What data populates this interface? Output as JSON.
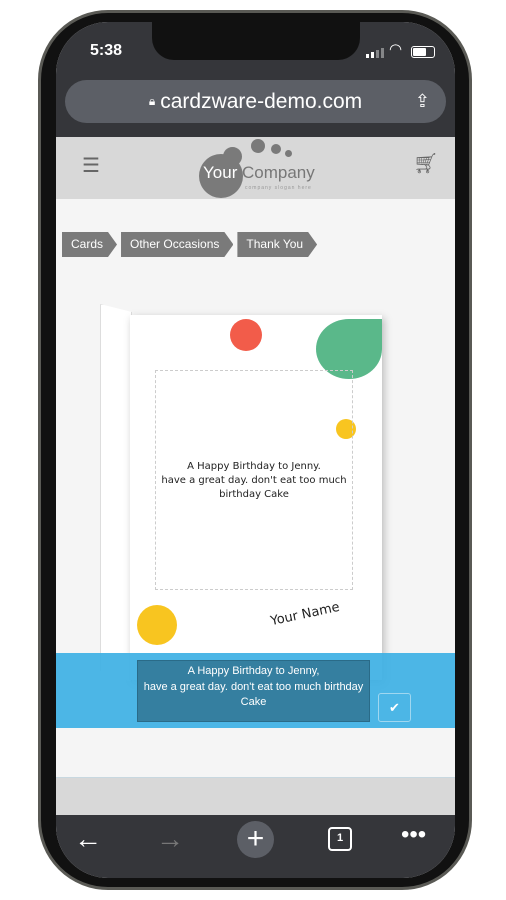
{
  "status": {
    "time": "5:38"
  },
  "browser": {
    "url": "cardzware-demo.com",
    "tab_count": "1"
  },
  "logo": {
    "word1": "Your",
    "word2": "Company",
    "slogan": "company slogan here"
  },
  "breadcrumbs": [
    "Cards",
    "Other Occasions",
    "Thank You"
  ],
  "card": {
    "message_lines": [
      "A Happy Birthday to Jenny.",
      "have a great day. don't eat too much",
      "birthday Cake"
    ],
    "signature": "Your Name"
  },
  "editor": {
    "text_lines": [
      "A Happy Birthday to Jenny,",
      "have a great day. don't eat too much birthday",
      "Cake"
    ]
  },
  "colors": {
    "accent": "#4ab6e6",
    "header": "#d8d8d8",
    "breadcrumb": "#7a7a7a"
  }
}
